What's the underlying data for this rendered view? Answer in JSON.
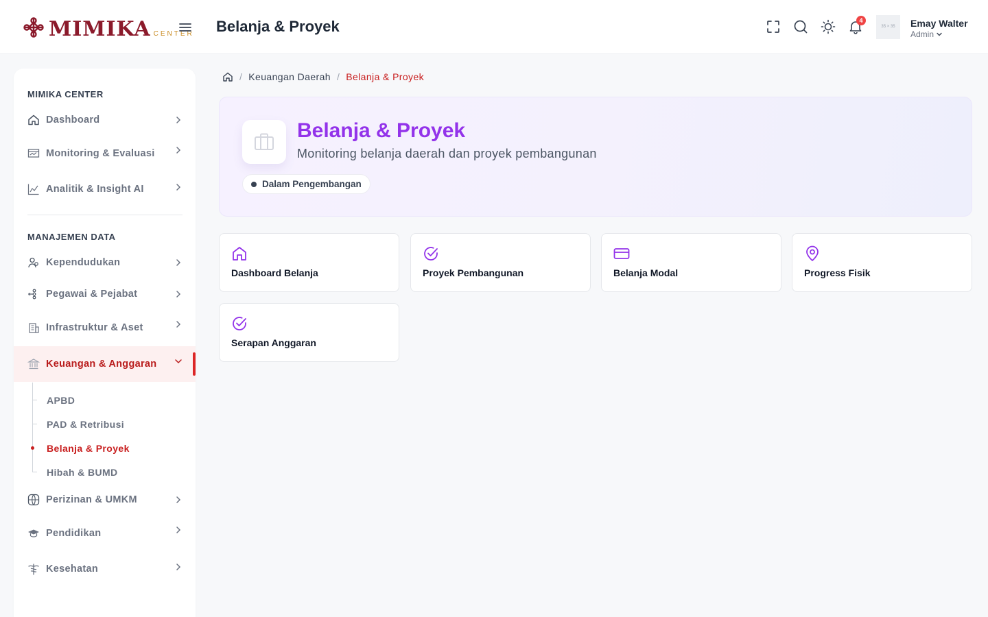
{
  "brand": {
    "name": "MIMIKA",
    "sub": "CENTER"
  },
  "header": {
    "title": "Belanja & Proyek",
    "notification_count": "4",
    "avatar_placeholder": "35 × 35",
    "user_name": "Emay Walter",
    "user_role": "Admin"
  },
  "sidebar": {
    "section1": "MIMIKA CENTER",
    "section2": "MANAJEMEN DATA",
    "items": [
      {
        "label": "Dashboard",
        "icon": "home-icon"
      },
      {
        "label": "Monitoring & Evaluasi",
        "icon": "monitor-icon"
      },
      {
        "label": "Analitik & Insight AI",
        "icon": "chart-icon"
      },
      {
        "label": "Kependudukan",
        "icon": "users-icon"
      },
      {
        "label": "Pegawai & Pejabat",
        "icon": "org-icon"
      },
      {
        "label": "Infrastruktur & Aset",
        "icon": "building-icon"
      },
      {
        "label": "Keuangan & Anggaran",
        "icon": "bank-icon"
      },
      {
        "label": "Perizinan & UMKM",
        "icon": "globe-icon"
      },
      {
        "label": "Pendidikan",
        "icon": "graduation-cap-icon"
      },
      {
        "label": "Kesehatan",
        "icon": "medical-icon"
      }
    ],
    "subitems": [
      "APBD",
      "PAD & Retribusi",
      "Belanja & Proyek",
      "Hibah & BUMD"
    ]
  },
  "breadcrumb": {
    "parent": "Keuangan Daerah",
    "current": "Belanja & Proyek"
  },
  "hero": {
    "title": "Belanja & Proyek",
    "subtitle": "Monitoring belanja daerah dan proyek pembangunan",
    "badge": "Dalam Pengembangan"
  },
  "cards": [
    {
      "label": "Dashboard Belanja",
      "icon": "home-icon"
    },
    {
      "label": "Proyek Pembangunan",
      "icon": "check-circle-icon"
    },
    {
      "label": "Belanja Modal",
      "icon": "credit-card-icon"
    },
    {
      "label": "Progress Fisik",
      "icon": "map-pin-icon"
    },
    {
      "label": "Serapan Anggaran",
      "icon": "check-circle-icon"
    }
  ],
  "colors": {
    "brand": "#8b1a2b",
    "accent_red": "#c81e1e",
    "accent_purple": "#9333ea"
  }
}
